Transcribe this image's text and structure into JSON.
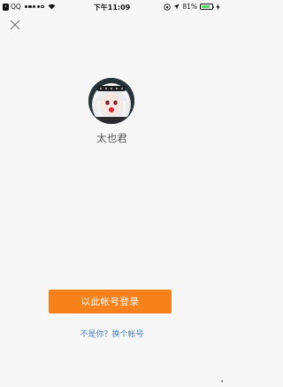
{
  "status_bar": {
    "carrier": "QQ",
    "back_glyph": "‹",
    "time": "下午11:09",
    "battery_text": "81%",
    "battery_level_percent": 81,
    "signal_bars_filled": 4,
    "signal_bars_total": 5
  },
  "header": {
    "close_icon": "close-icon"
  },
  "profile": {
    "username": "太也君"
  },
  "actions": {
    "login_label": "以此帐号登录",
    "switch_account_label": "不是你？换个帐号"
  },
  "colors": {
    "background": "#f7f7f7",
    "accent": "#f7811b",
    "link": "#4a7ebb",
    "battery": "#4cd964"
  }
}
